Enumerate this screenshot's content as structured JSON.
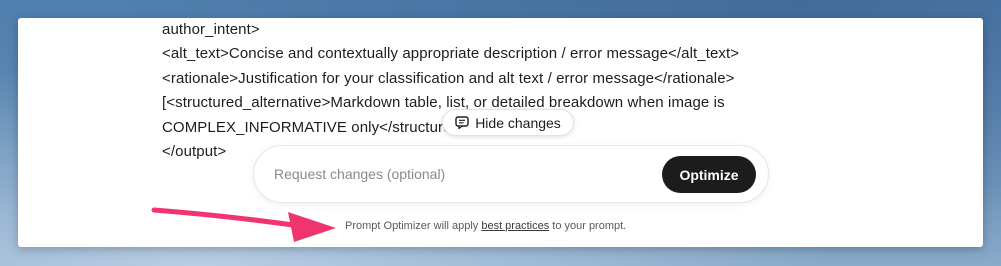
{
  "prompt_text": {
    "lines": [
      "author_intent>",
      "<alt_text>Concise and contextually appropriate description / error message</alt_text>",
      "<rationale>Justification for your classification and alt text / error message</rationale>",
      "[<structured_alternative>Markdown table, list, or detailed breakdown when image is",
      "COMPLEX_INFORMATIVE only</structured_alternative>]",
      "</output>"
    ]
  },
  "hide_changes": {
    "label": "Hide changes",
    "icon": "comment-icon"
  },
  "request": {
    "placeholder": "Request changes (optional)",
    "value": ""
  },
  "optimize_button": {
    "label": "Optimize"
  },
  "footer": {
    "prefix": "Prompt Optimizer will apply ",
    "link": "best practices",
    "suffix": " to your prompt."
  },
  "annotation": {
    "arrow_color": "#f0356e",
    "icon": "arrow-right-icon"
  }
}
